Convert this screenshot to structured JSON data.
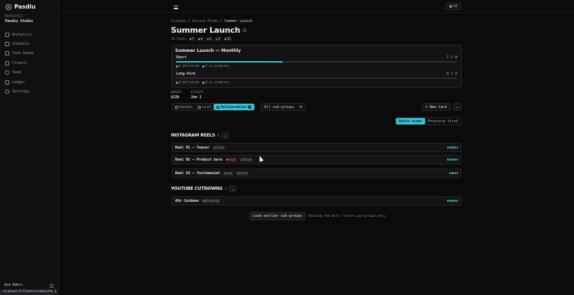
{
  "app": {
    "name": "Pasdiu"
  },
  "workspace": {
    "label": "WORKSPACE",
    "name": "Pasdiu Studio"
  },
  "nav": [
    {
      "label": "Analytics",
      "icon": "chart-icon"
    },
    {
      "label": "Schedule",
      "icon": "calendar-icon"
    },
    {
      "label": "Task Queue",
      "icon": "queue-icon"
    },
    {
      "label": "Clients",
      "icon": "clients-icon"
    },
    {
      "label": "Team",
      "icon": "team-icon"
    },
    {
      "label": "Ledger",
      "icon": "ledger-icon"
    },
    {
      "label": "Settings",
      "icon": "settings-icon"
    }
  ],
  "user": {
    "name": "Ava Admin"
  },
  "status_url": "localhost:5173/deliverables/del_2",
  "search": {
    "shortcut": "⌘K"
  },
  "breadcrumb": {
    "a": "Clients",
    "b": "Aurora Films",
    "current": "Summer Launch",
    "sep": "/"
  },
  "page": {
    "title": "Summer Launch"
  },
  "stats": {
    "tasks": "24 tasks",
    "chips": [
      {
        "value": "7",
        "color": "#8a8a8a"
      },
      {
        "value": "4",
        "color": "#35c3d5"
      },
      {
        "value": "3",
        "color": "#e0b43a"
      },
      {
        "value": "3",
        "color": "#e05d5d"
      },
      {
        "value": "12",
        "color": "#3ec77a"
      }
    ]
  },
  "card": {
    "title": "Summer Launch — Monthly",
    "rows": [
      {
        "label": "Short",
        "count": "7 / 8",
        "progress": 0.38,
        "delivered": "4 delivered",
        "in_progress": "3 in progress"
      },
      {
        "label": "Long-form",
        "count": "0 / 2",
        "progress": 0,
        "delivered": "0 delivered",
        "in_progress": "0 in progress"
      }
    ]
  },
  "meta": {
    "budget_label": "BUDGET",
    "budget_value": "$12k",
    "kickoff_label": "KICKOFF",
    "kickoff_value": "Jun 1"
  },
  "views": {
    "kanban": "Kanban",
    "list": "List",
    "deliverables": "Deliverables",
    "deliverables_count": "4"
  },
  "filter": {
    "selected": "All sub-groups"
  },
  "actions": {
    "new_task": "+ New task",
    "more": "…"
  },
  "sort": {
    "batch": "Batch order",
    "priority": "Priority first"
  },
  "groups": [
    {
      "name": "INSTAGRAM REELS",
      "count": "3",
      "tasks": [
        {
          "name": "Reel 01 — Teaser",
          "tags": [
            {
              "text": "active",
              "kind": "status"
            }
          ],
          "dots": [
            "#3ec77a",
            "#3ec77a",
            "#35c3d5",
            "#35c3d5",
            "#8a8a8a"
          ]
        },
        {
          "name": "Reel 02 — Product hero",
          "tags": [
            {
              "text": "High",
              "kind": "high"
            },
            {
              "text": "active",
              "kind": "status"
            }
          ],
          "dots": [
            "#3ec77a",
            "#3ec77a",
            "#35c3d5",
            "#35c3d5",
            "#8a8a8a"
          ]
        },
        {
          "name": "Reel 03 — Testimonial",
          "tags": [
            {
              "text": "Low",
              "kind": "low"
            },
            {
              "text": "active",
              "kind": "status"
            }
          ],
          "dots": [
            "#3ec77a",
            "#3ec77a",
            "#35c3d5",
            "#8a8a8a"
          ]
        }
      ]
    },
    {
      "name": "YOUTUBE CUTDOWNS",
      "count": "1",
      "tasks": [
        {
          "name": "60s Cutdown",
          "tags": [
            {
              "text": "delivered",
              "kind": "status"
            }
          ],
          "dots": [
            "#3ec77a",
            "#3ec77a",
            "#3ec77a",
            "#3ec77a",
            "#3ec77a"
          ]
        }
      ]
    }
  ],
  "load_more": {
    "button": "Load earlier sub-groups",
    "note": "Showing the most recent sub-groups only."
  }
}
